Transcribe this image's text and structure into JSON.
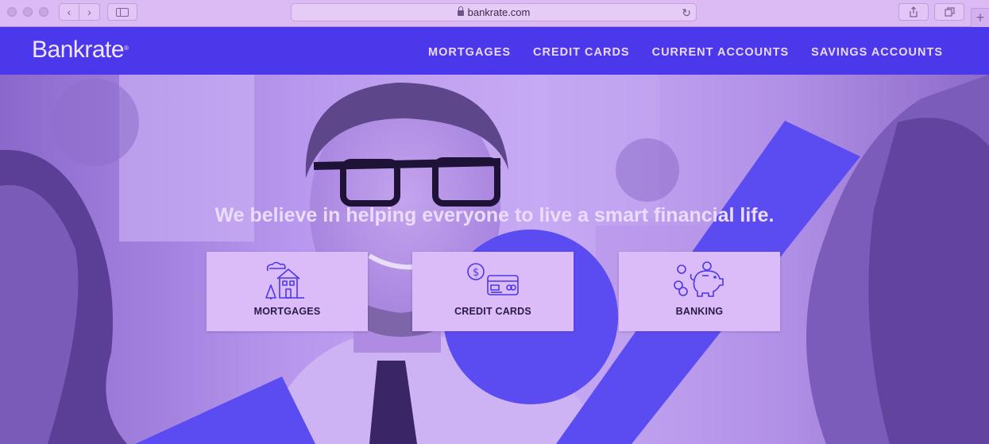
{
  "browser": {
    "url": "bankrate.com",
    "icons": [
      "close-dot",
      "minimize-dot",
      "maximize-dot",
      "back-icon",
      "forward-icon",
      "sidebar-icon",
      "lock-icon",
      "reload-icon",
      "share-icon",
      "tabs-icon",
      "new-tab-icon"
    ]
  },
  "header": {
    "logo": "Bankrate",
    "logo_mark": "®",
    "nav": [
      "MORTGAGES",
      "CREDIT CARDS",
      "CURRENT ACCOUNTS",
      "SAVINGS ACCOUNTS"
    ]
  },
  "hero": {
    "title": "We believe in helping everyone to live a smart financial life.",
    "cards": [
      {
        "label": "MORTGAGES",
        "icon": "house-icon"
      },
      {
        "label": "CREDIT CARDS",
        "icon": "credit-card-icon"
      },
      {
        "label": "BANKING",
        "icon": "piggy-bank-icon"
      }
    ]
  },
  "colors": {
    "header_bg": "#4a38ea",
    "accent_shape": "#5a4cf0",
    "card_bg": "#dbbcf9",
    "chrome_bg": "#dcbaf3"
  }
}
